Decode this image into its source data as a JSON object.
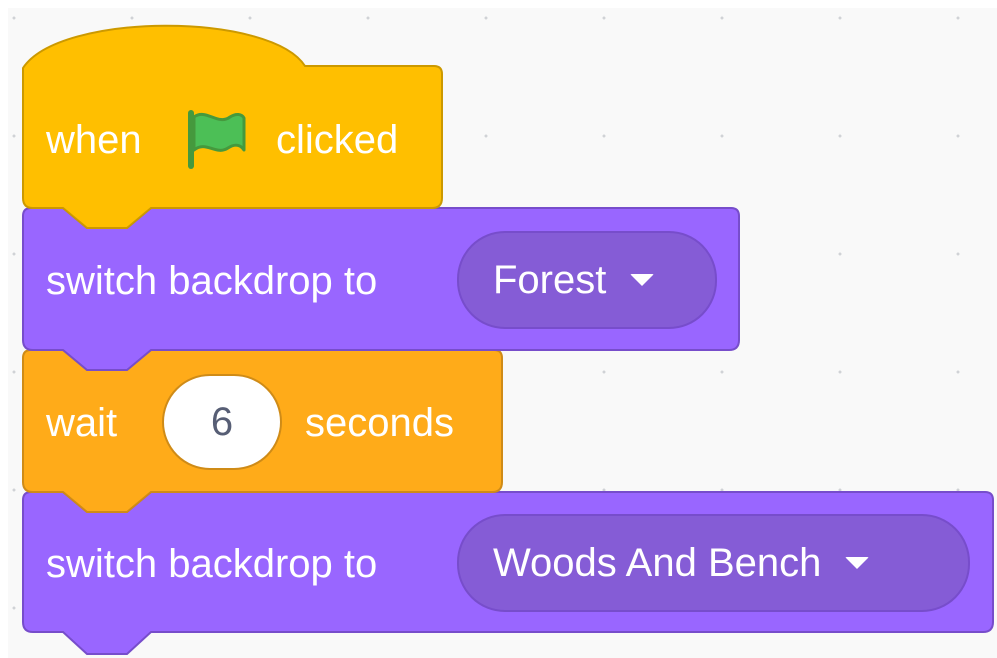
{
  "colors": {
    "events": "#ffbf00",
    "events_border": "#cc9900",
    "looks": "#9966ff",
    "looks_border": "#774dcb",
    "looks_dropdown": "#855cd6",
    "control": "#ffab19",
    "control_border": "#cf8b17",
    "flag": "#4cbf56",
    "flag_border": "#45993d",
    "input_text": "#575e75"
  },
  "script": {
    "hat_block": {
      "when_label": "when",
      "icon": "green-flag-icon",
      "clicked_label": "clicked"
    },
    "backdrop_block_1": {
      "label": "switch backdrop to",
      "value": "Forest"
    },
    "wait_block": {
      "wait_label": "wait",
      "value": "6",
      "seconds_label": "seconds"
    },
    "backdrop_block_2": {
      "label": "switch backdrop to",
      "value": "Woods And Bench"
    }
  }
}
